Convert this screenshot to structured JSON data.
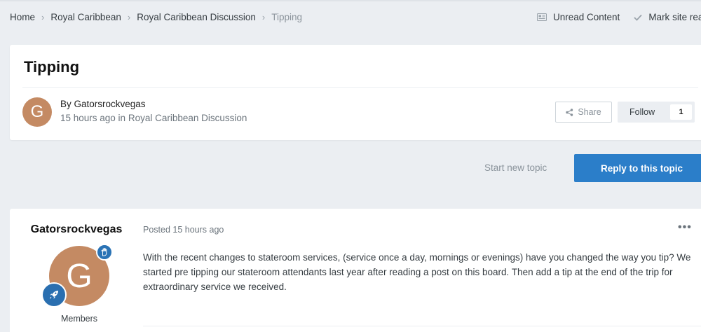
{
  "breadcrumb": {
    "items": [
      "Home",
      "Royal Caribbean",
      "Royal Caribbean Discussion"
    ],
    "current": "Tipping",
    "separator": "›"
  },
  "quick_links": {
    "unread": "Unread Content",
    "mark_read": "Mark site read"
  },
  "topic": {
    "title": "Tipping",
    "byline": "By Gatorsrockvegas",
    "meta": "15 hours ago in Royal Caribbean Discussion",
    "avatar_letter": "G",
    "share_label": "Share",
    "follow_label": "Follow",
    "follow_count": "1"
  },
  "actions": {
    "start_topic": "Start new topic",
    "reply": "Reply to this topic"
  },
  "post": {
    "author": "Gatorsrockvegas",
    "avatar_letter": "G",
    "group": "Members",
    "posted": "Posted 15 hours ago",
    "menu": "•••",
    "body": "With the recent changes to stateroom services, (service once a day, mornings or evenings) have you changed the way you tip? We started pre tipping our stateroom attendants last year after reading a post on this board. Then add a tip at the end of the trip for extraordinary service we received."
  },
  "colors": {
    "background": "#ebeef2",
    "accent": "#2b7ec9",
    "avatar": "#c48a63",
    "badge": "#2a73b5"
  },
  "icons": {
    "unread": "newspaper-icon",
    "mark_read": "check-icon",
    "share": "share-icon",
    "badge_top": "hand-icon",
    "badge_rank": "rocket-icon"
  }
}
